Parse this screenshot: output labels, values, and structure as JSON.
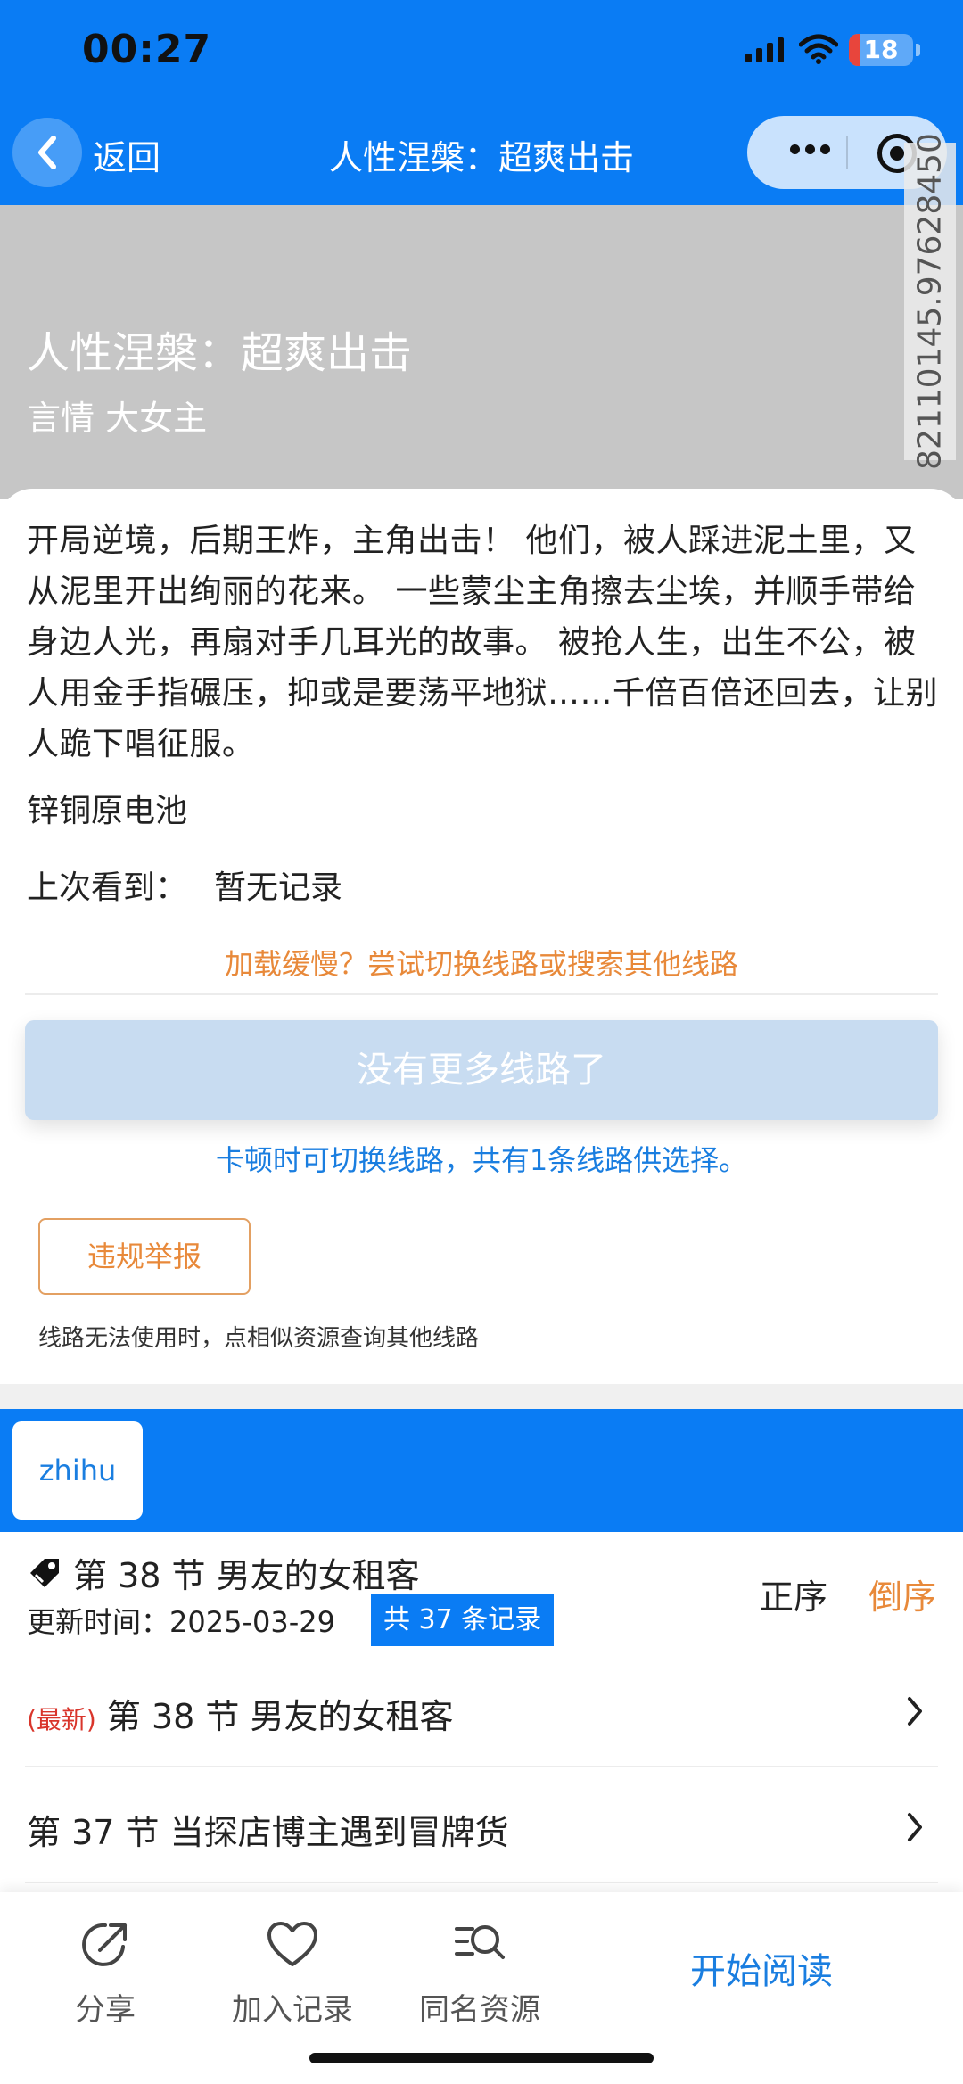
{
  "status": {
    "time": "00:27",
    "battery": "18"
  },
  "nav": {
    "back_label": "返回",
    "title": "人性涅槃：超爽出击"
  },
  "watermark": "82110145.97628450",
  "hero": {
    "title": "人性涅槃：超爽出击",
    "tags": "言情 大女主"
  },
  "book": {
    "description": "开局逆境，后期王炸，主角出击！ 他们，被人踩进泥土里，又从泥里开出绚丽的花来。 一些蒙尘主角擦去尘埃，并顺手带给身边人光，再扇对手几耳光的故事。 被抢人生，出生不公，被人用金手指碾压，抑或是要荡平地狱……千倍百倍还回去，让别人跪下唱征服。",
    "author": "锌铜原电池",
    "last_seen_label": "上次看到：",
    "last_seen_value": "暂无记录"
  },
  "route": {
    "slow_tip": "加载缓慢？尝试切换线路或搜索其他线路",
    "no_more_label": "没有更多线路了",
    "switch_tip": "卡顿时可切换线路，共有1条线路供选择。",
    "report_label": "违规举报",
    "unusable_tip": "线路无法使用时，点相似资源查询其他线路"
  },
  "sources": {
    "tabs": [
      "zhihu"
    ]
  },
  "chapters": {
    "latest_title": "第 38 节 男友的女租客",
    "update_time": "更新时间：2025-03-29",
    "count_badge": "共 37 条记录",
    "sort_asc": "正序",
    "sort_desc": "倒序",
    "newest_tag": "(最新)",
    "items": [
      {
        "title": "第 38 节 男友的女租客"
      },
      {
        "title": "第 37 节 当探店博主遇到冒牌货"
      }
    ]
  },
  "bottom": {
    "share": "分享",
    "add_record": "加入记录",
    "same_name": "同名资源",
    "start_reading": "开始阅读"
  },
  "colors": {
    "primary": "#0a7cf4",
    "accent": "#e8893a",
    "link": "#1a7ee0",
    "hero_bg": "#c6c6c6"
  }
}
